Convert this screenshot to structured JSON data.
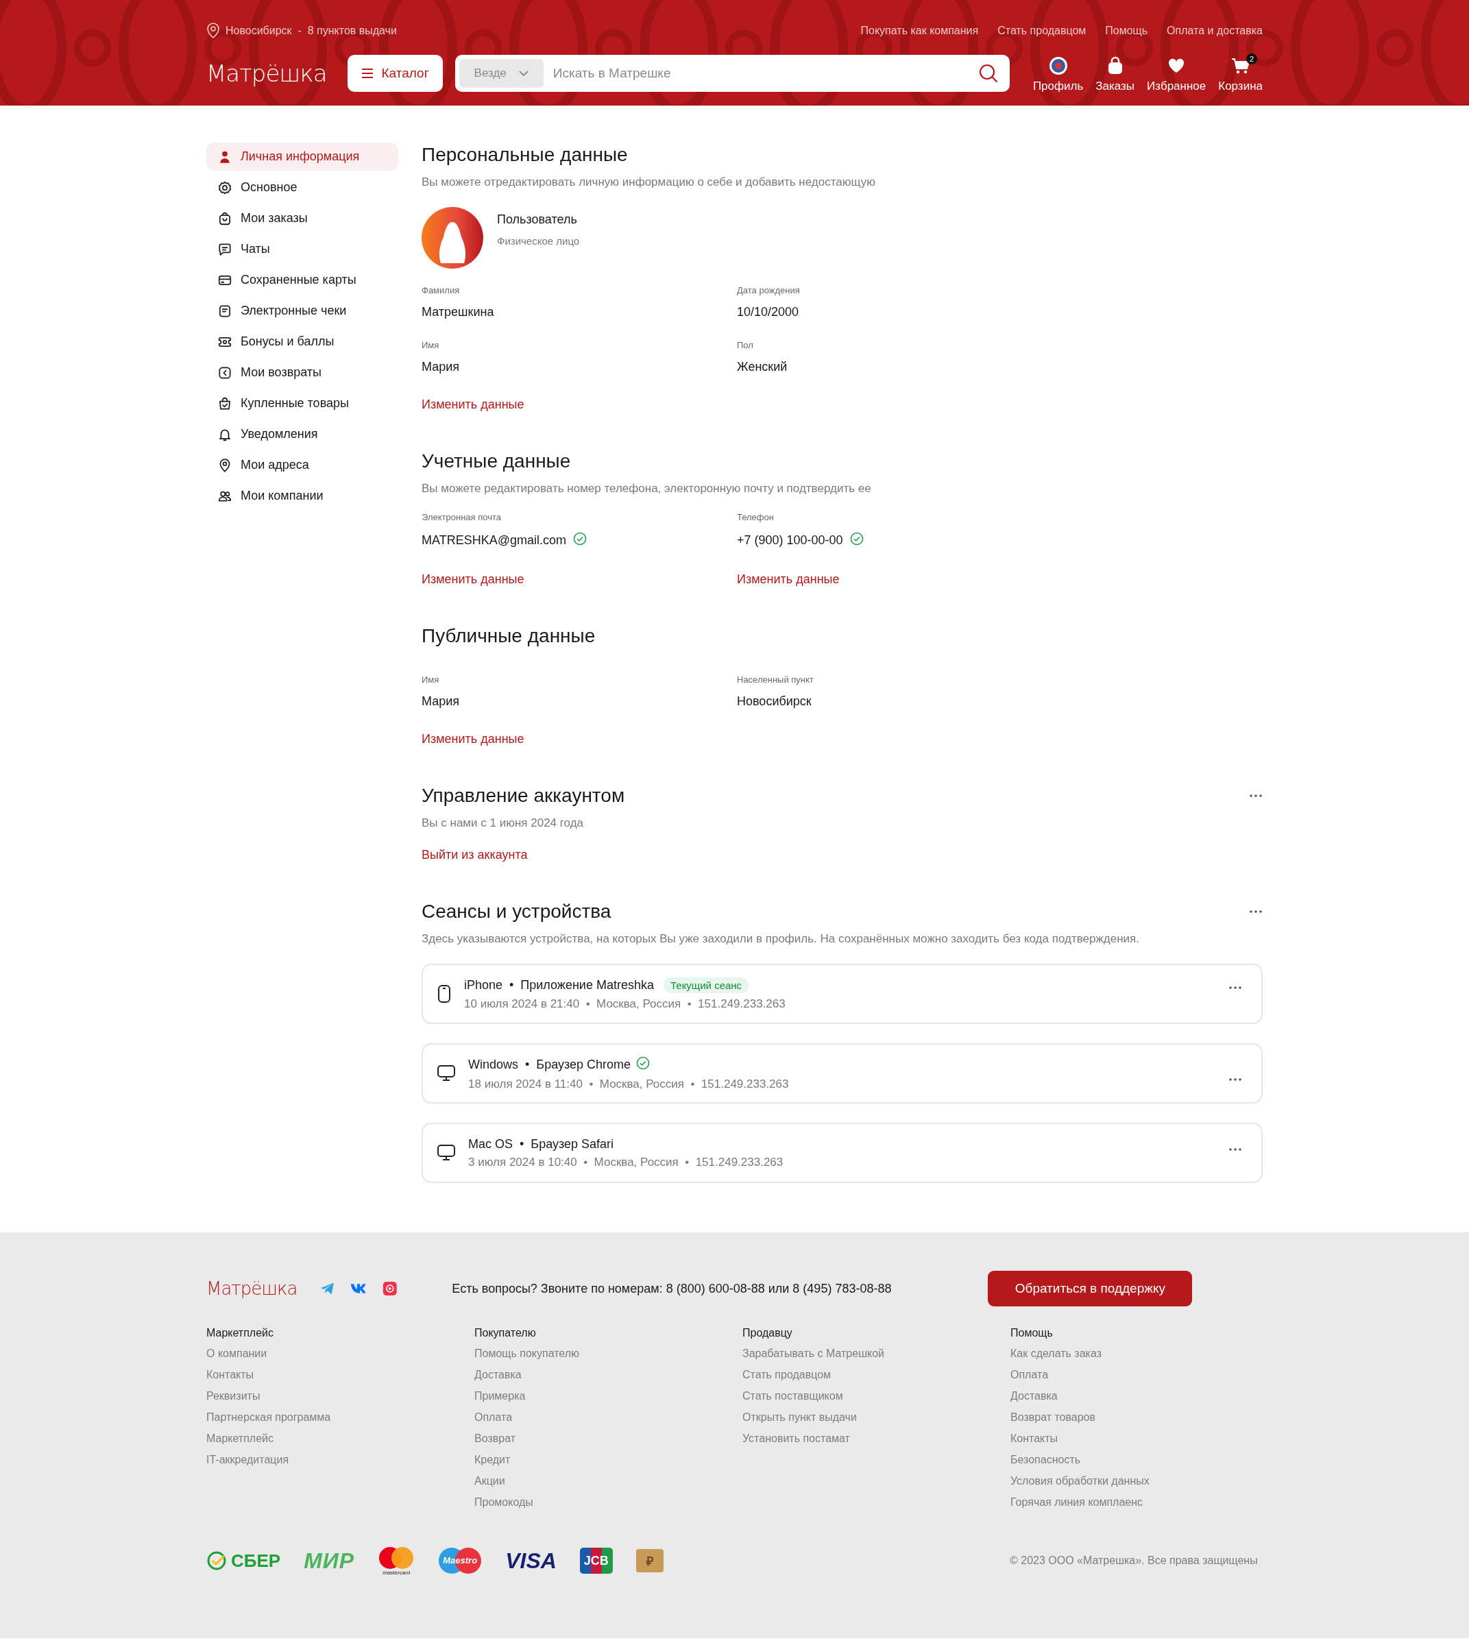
{
  "header": {
    "location": "Новосибирск  -  8 пунктов выдачи",
    "links": [
      "Покупать как компания",
      "Стать продавцом",
      "Помощь",
      "Оплата и доставка"
    ],
    "logo": "Матрёшка",
    "catalog_button": "Каталог",
    "search": {
      "scope": "Везде",
      "placeholder": "Искать в Матрешке"
    },
    "nav": [
      {
        "kind": "profile",
        "label": "Профиль"
      },
      {
        "kind": "orders",
        "label": "Заказы"
      },
      {
        "kind": "favorites",
        "label": "Избранное"
      },
      {
        "kind": "cart",
        "label": "Корзина",
        "badge": "2"
      }
    ]
  },
  "sidebar": {
    "items": [
      {
        "label": "Личная информация",
        "selected": true
      },
      {
        "label": "Основное",
        "selected": false
      },
      {
        "label": "Мои заказы",
        "selected": false
      },
      {
        "label": "Чаты",
        "selected": false
      },
      {
        "label": "Сохраненные карты",
        "selected": false
      },
      {
        "label": "Электронные чеки",
        "selected": false
      },
      {
        "label": "Бонусы и баллы",
        "selected": false
      },
      {
        "label": "Мои возвраты",
        "selected": false
      },
      {
        "label": "Купленные товары",
        "selected": false
      },
      {
        "label": "Уведомления",
        "selected": false
      },
      {
        "label": "Мои адреса",
        "selected": false
      },
      {
        "label": "Мои компании",
        "selected": false
      }
    ]
  },
  "personal": {
    "title": "Персональные данные",
    "subtitle": "Вы можете отредактировать личную информацию о себе и добавить недостающую",
    "user": {
      "name": "Пользователь",
      "type": "Физическое лицо"
    },
    "fields": [
      {
        "label": "Фамилия",
        "value": "Матрешкина"
      },
      {
        "label": "Дата рождения",
        "value": "10/10/2000"
      },
      {
        "label": "Имя",
        "value": "Мария"
      },
      {
        "label": "Пол",
        "value": "Женский"
      }
    ],
    "action": "Изменить данные"
  },
  "account": {
    "title": "Учетные данные",
    "subtitle": "Вы можете редактировать номер телефона, электоронную почту и подтвердить ее",
    "fields": [
      {
        "label": "Электронная почта",
        "value": "MATRESHKA@gmail.com",
        "verified": true,
        "action": "Изменить данные"
      },
      {
        "label": "Телефон",
        "value": "+7 (900) 100-00-00",
        "verified": true,
        "action": "Изменить данные"
      }
    ]
  },
  "public": {
    "title": "Публичные данные",
    "fields": [
      {
        "label": "Имя",
        "value": "Мария"
      },
      {
        "label": "Населенный пункт",
        "value": "Новосибирск"
      }
    ],
    "action": "Изменить данные"
  },
  "manage": {
    "title": "Управление аккаунтом",
    "subtitle": "Вы с нами с 1 июня 2024 года",
    "action": "Выйти из аккаунта"
  },
  "sessions": {
    "title": "Сеансы и устройства",
    "subtitle": "Здесь указываются устройства, на которых  Вы уже заходили в профиль. На сохранённых можно заходить без кода подтверждения.",
    "items": [
      {
        "kind": "phone",
        "title": "iPhone  •  Приложение Matreshka",
        "tag": "Текущий сеанс",
        "verified": false,
        "details": "10 июля 2024 в 21:40  •  Москва, Россия  •  151.249.233.263"
      },
      {
        "kind": "desktop",
        "title": "Windows  •  Браузер Chrome",
        "verified": true,
        "details": "18 июля 2024 в 11:40  •  Москва, Россия  •  151.249.233.263"
      },
      {
        "kind": "desktop",
        "title": "Mac OS  •  Браузер Safari",
        "verified": false,
        "details": "3 июля 2024 в 10:40  •  Москва, Россия  •  151.249.233.263"
      }
    ]
  },
  "footer": {
    "logo": "Матрёшка",
    "phone_text": "Есть вопросы? Звоните по номерам: 8 (800) 600-08-88 или 8 (495) 783-08-88",
    "support_button": "Обратиться в поддержку",
    "columns": [
      {
        "title": "Маркетплейс",
        "links": [
          "О компании",
          "Контакты",
          "Реквизиты",
          "Партнерская программа",
          "Маркетплейс",
          "IT-аккредитация"
        ]
      },
      {
        "title": "Покупателю",
        "links": [
          "Помощь покупателю",
          "Доставка",
          "Примерка",
          "Оплата",
          "Возврат",
          "Кредит",
          "Акции",
          "Промокоды"
        ]
      },
      {
        "title": "Продавцу",
        "links": [
          "Зарабатывать с Матрешкой",
          "Стать продавцом",
          "Стать поставщиком",
          "Открыть пункт выдачи",
          "Установить постамат"
        ]
      },
      {
        "title": "Помощь",
        "links": [
          "Как сделать заказ",
          "Оплата",
          "Доставка",
          "Возврат товаров",
          "Контакты",
          "Безопасность",
          "Условия обработки данных",
          "Горячая линия комплаенс"
        ]
      }
    ],
    "payments": [
      {
        "kind": "sber",
        "label": "СБЕР"
      },
      {
        "kind": "mir",
        "label": "МИР"
      },
      {
        "kind": "mastercard",
        "label": "mastercard"
      },
      {
        "kind": "maestro",
        "label": "Maestro"
      },
      {
        "kind": "visa",
        "label": "VISA"
      },
      {
        "kind": "jcb",
        "label": "JCB"
      },
      {
        "kind": "wallet",
        "label": "₽"
      }
    ],
    "copyright": "© 2023 ООО «Матрешка». Все права защищены"
  }
}
